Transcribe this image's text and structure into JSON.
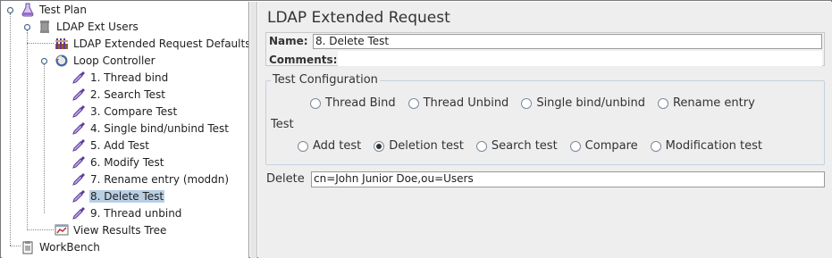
{
  "tree": {
    "root": "Test Plan",
    "thread_group": "LDAP Ext Users",
    "defaults": "LDAP Extended Request Defaults",
    "loop": "Loop Controller",
    "samplers": [
      "1. Thread bind",
      "2. Search Test",
      "3. Compare Test",
      "4. Single bind/unbind Test",
      "5. Add Test",
      "6. Modify Test",
      "7. Rename entry (moddn)",
      "8. Delete Test",
      "9. Thread unbind"
    ],
    "listener": "View Results Tree",
    "workbench": "WorkBench",
    "selected_index": 7
  },
  "panel": {
    "title": "LDAP Extended Request",
    "name_label": "Name:",
    "name_value": "8. Delete Test",
    "comments_label": "Comments:",
    "config_group_title": "Test Configuration",
    "config_options": [
      "Thread Bind",
      "Thread Unbind",
      "Single bind/unbind",
      "Rename entry"
    ],
    "test_label": "Test",
    "test_options": [
      "Add test",
      "Deletion test",
      "Search test",
      "Compare",
      "Modification test"
    ],
    "selected_test": "Deletion test",
    "delete_label": "Delete",
    "delete_value": "cn=John Junior Doe,ou=Users"
  },
  "colors": {
    "selection": "#b8cfe5",
    "panel_bg": "#eeeeee"
  },
  "icons": {
    "root": "test-plan-flask-icon",
    "thread_group": "thread-group-spool-icon",
    "defaults": "config-element-icon",
    "loop": "loop-controller-icon",
    "sampler": "sampler-pipette-icon",
    "listener": "listener-graph-icon",
    "workbench": "workbench-clipboard-icon"
  }
}
